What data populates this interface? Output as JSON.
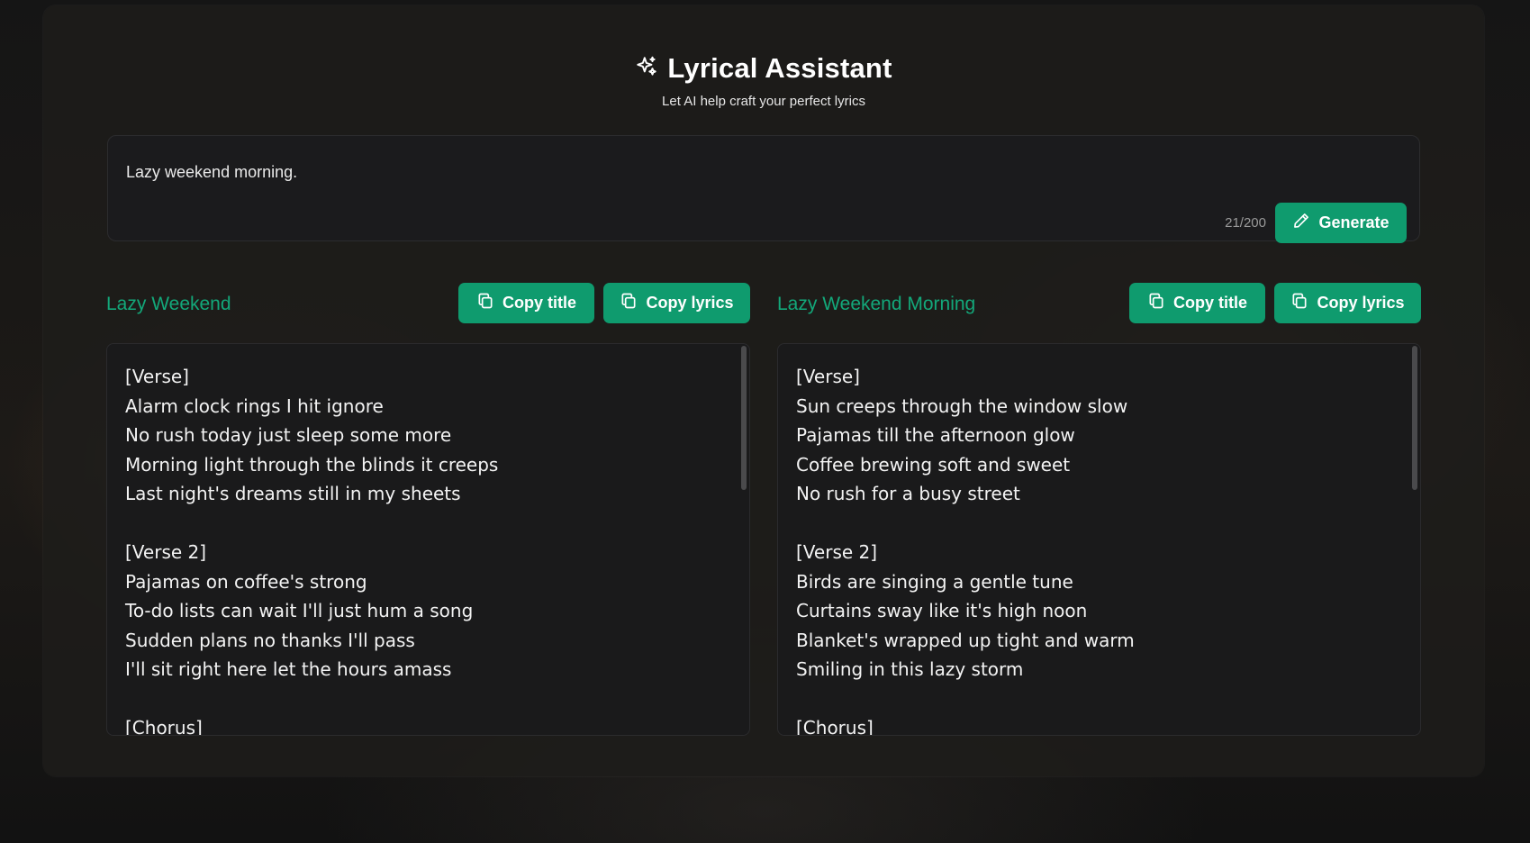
{
  "header": {
    "icon": "sparkles-icon",
    "title": "Lyrical Assistant",
    "subtitle": "Let AI help craft your perfect lyrics"
  },
  "prompt": {
    "value": "Lazy weekend morning.",
    "char_count": "21/200",
    "generate_label": "Generate",
    "generate_icon": "pencil-icon"
  },
  "results": [
    {
      "title": "Lazy Weekend",
      "copy_title_label": "Copy title",
      "copy_lyrics_label": "Copy lyrics",
      "lyrics": "[Verse]\nAlarm clock rings I hit ignore\nNo rush today just sleep some more\nMorning light through the blinds it creeps\nLast night's dreams still in my sheets\n\n[Verse 2]\nPajamas on coffee's strong\nTo-do lists can wait I'll just hum a song\nSudden plans no thanks I'll pass\nI'll sit right here let the hours amass\n\n[Chorus]"
    },
    {
      "title": "Lazy Weekend Morning",
      "copy_title_label": "Copy title",
      "copy_lyrics_label": "Copy lyrics",
      "lyrics": "[Verse]\nSun creeps through the window slow\nPajamas till the afternoon glow\nCoffee brewing soft and sweet\nNo rush for a busy street\n\n[Verse 2]\nBirds are singing a gentle tune\nCurtains sway like it's high noon\nBlanket's wrapped up tight and warm\nSmiling in this lazy storm\n\n[Chorus]"
    }
  ],
  "colors": {
    "accent": "#0f9b6e",
    "accent_text": "#13a87a",
    "panel": "#1e1c1a"
  }
}
